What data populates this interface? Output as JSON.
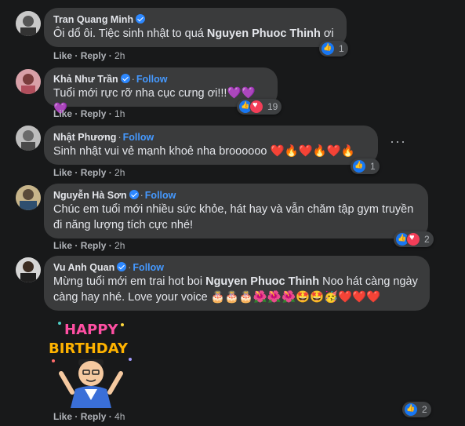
{
  "comments": [
    {
      "name": "Tran Quang Minh",
      "verified": true,
      "follow": "",
      "text_parts": [
        "Ôi dổ ôi. Tiệc sinh nhật to quá ",
        "Nguyen Phuoc Thinh",
        " ơi"
      ],
      "like": "Like",
      "reply": "Reply",
      "time": "2h",
      "reaction_count": "1",
      "reactions": [
        "like"
      ]
    },
    {
      "name": "Khả Như Trần",
      "verified": true,
      "follow": "Follow",
      "text": "Tuổi mới rực rỡ nha cục cưng ơi!!!💜💜💜",
      "like": "Like",
      "reply": "Reply",
      "time": "1h",
      "reaction_count": "19",
      "reactions": [
        "like",
        "love"
      ]
    },
    {
      "name": "Nhật Phương",
      "verified": false,
      "follow": "Follow",
      "text": "Sinh nhật vui vẻ mạnh khoẻ nha broooooo ❤️🔥❤️🔥❤️🔥",
      "like": "Like",
      "reply": "Reply",
      "time": "2h",
      "reaction_count": "1",
      "reactions": [
        "like"
      ]
    },
    {
      "name": "Nguyễn Hà Sơn",
      "verified": true,
      "follow": "Follow",
      "text": "Chúc em tuổi mới nhiều sức khỏe, hát hay và vẫn chăm tập gym truyền đi năng lượng tích cực nhé!",
      "like": "Like",
      "reply": "Reply",
      "time": "2h",
      "reaction_count": "2",
      "reactions": [
        "like",
        "love"
      ]
    },
    {
      "name": "Vu Anh Quan",
      "verified": true,
      "follow": "Follow",
      "text_parts": [
        "Mừng tuổi mới em trai hot boi ",
        "Nguyen Phuoc Thinh",
        " Noo hát càng ngày càng hay nhé. Love your voice 🎂🎂🎂🌺🌺🌺🤩🤩🥳❤️❤️❤️"
      ],
      "like": "Like",
      "reply": "Reply",
      "time": "4h",
      "reaction_count": "2",
      "reactions": [
        "like"
      ],
      "sticker_text": [
        "HAPPY",
        "BIRTHDAY"
      ]
    }
  ],
  "icons": {
    "more": "more-options-icon",
    "verified": "verified-badge-icon"
  },
  "colors": {
    "link": "#4599ff",
    "bubble": "#3a3b3c",
    "background": "#18191a"
  }
}
